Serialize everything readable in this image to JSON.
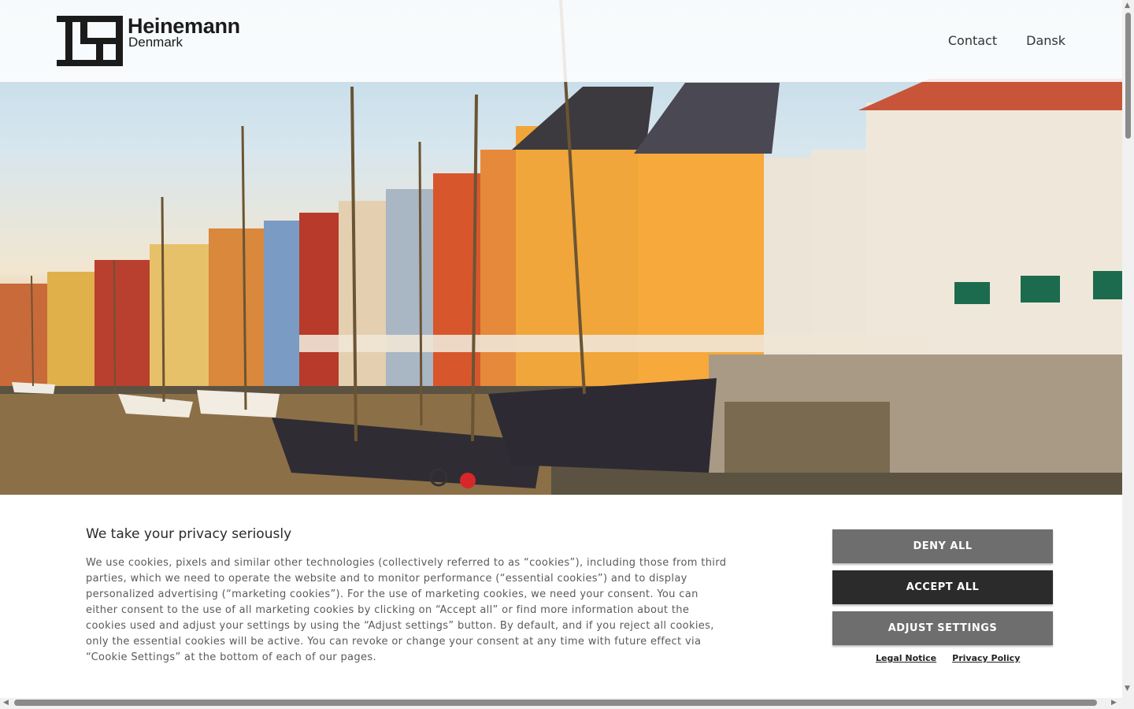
{
  "header": {
    "logo_name": "Heinemann",
    "logo_sub": "Denmark",
    "nav": [
      "Contact",
      "Dansk"
    ]
  },
  "hero": {
    "description_icon": "harbor-image"
  },
  "cookie": {
    "title": "We take your privacy seriously",
    "text": "We use cookies, pixels and similar other technologies (collectively referred to as “cookies”), including those from third parties, which we need to operate the website and to monitor performance (“essential cookies”) and to display personalized advertising (“marketing cookies”). For the use of marketing cookies, we need your consent. You can either consent to the use of all marketing cookies by clicking on “Accept all” or find more information about the cookies used and adjust your settings by using the “Adjust settings” button. By default, and if you reject all cookies, only the essential cookies will be active. You can revoke or change your consent at any time with future effect via “Cookie Settings” at the bottom of each of our pages.",
    "buttons": {
      "deny": "DENY ALL",
      "accept": "ACCEPT ALL",
      "adjust": "ADJUST SETTINGS"
    },
    "links": {
      "legal": "Legal Notice",
      "privacy": "Privacy Policy"
    }
  },
  "colors": {
    "button_gray": "#6e6e6e",
    "button_dark": "#2b2b2b"
  }
}
